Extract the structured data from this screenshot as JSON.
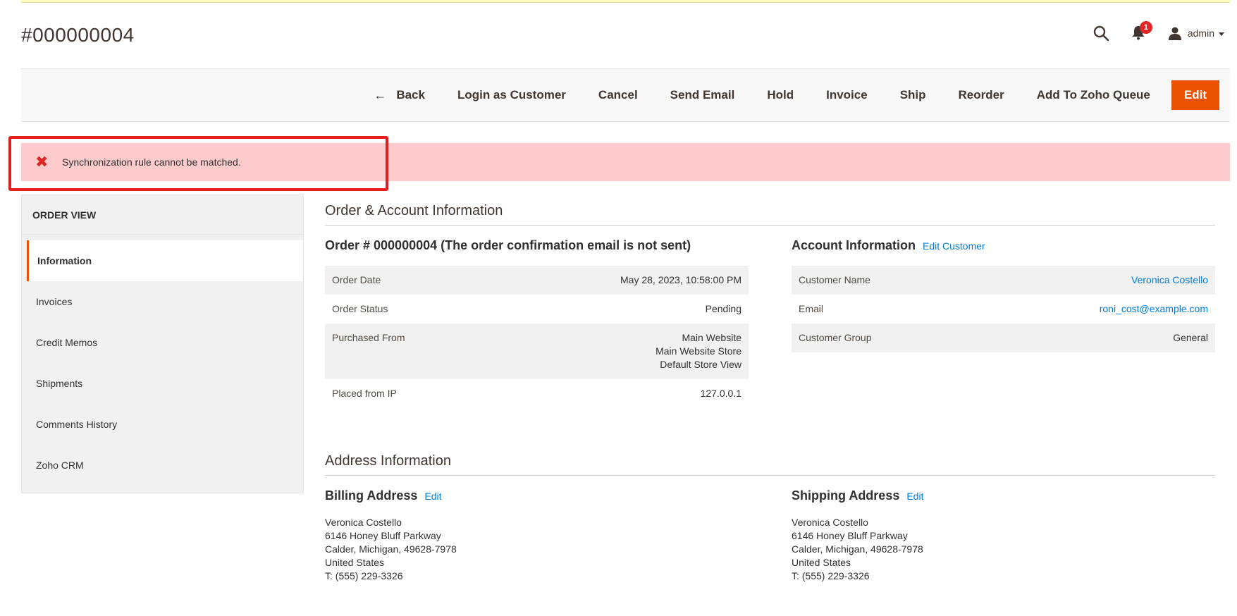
{
  "header": {
    "page_title": "#000000004",
    "notifications_count": "1",
    "user_name": "admin"
  },
  "actions": {
    "back": "Back",
    "login_as_customer": "Login as Customer",
    "cancel": "Cancel",
    "send_email": "Send Email",
    "hold": "Hold",
    "invoice": "Invoice",
    "ship": "Ship",
    "reorder": "Reorder",
    "add_to_zoho": "Add To Zoho Queue",
    "edit": "Edit"
  },
  "message": {
    "error_text": "Synchronization rule cannot be matched."
  },
  "sidebar": {
    "title": "ORDER VIEW",
    "items": [
      {
        "label": "Information"
      },
      {
        "label": "Invoices"
      },
      {
        "label": "Credit Memos"
      },
      {
        "label": "Shipments"
      },
      {
        "label": "Comments History"
      },
      {
        "label": "Zoho CRM"
      }
    ]
  },
  "order_account": {
    "section_title": "Order & Account Information",
    "order": {
      "title": "Order # 000000004 (The order confirmation email is not sent)",
      "order_date_label": "Order Date",
      "order_date": "May 28, 2023, 10:58:00 PM",
      "status_label": "Order Status",
      "status": "Pending",
      "purchased_from_label": "Purchased From",
      "purchased_from_1": "Main Website",
      "purchased_from_2": "Main Website Store",
      "purchased_from_3": "Default Store View",
      "ip_label": "Placed from IP",
      "ip": "127.0.0.1"
    },
    "account": {
      "title": "Account Information",
      "edit_link": "Edit Customer",
      "name_label": "Customer Name",
      "name": "Veronica Costello",
      "email_label": "Email",
      "email": "roni_cost@example.com",
      "group_label": "Customer Group",
      "group": "General"
    }
  },
  "address": {
    "section_title": "Address Information",
    "billing": {
      "title": "Billing Address",
      "edit_link": "Edit",
      "name": "Veronica Costello",
      "street": "6146 Honey Bluff Parkway",
      "city": "Calder, Michigan, 49628-7978",
      "country": "United States",
      "phone": "T: (555) 229-3326"
    },
    "shipping": {
      "title": "Shipping Address",
      "edit_link": "Edit",
      "name": "Veronica Costello",
      "street": "6146 Honey Bluff Parkway",
      "city": "Calder, Michigan, 49628-7978",
      "country": "United States",
      "phone": "T: (555) 229-3326"
    }
  },
  "colors": {
    "accent": "#eb5202",
    "error_bg": "#fdcbcb",
    "error_icon": "#e22626",
    "link": "#007bdb",
    "highlight": "#e41e1e"
  }
}
